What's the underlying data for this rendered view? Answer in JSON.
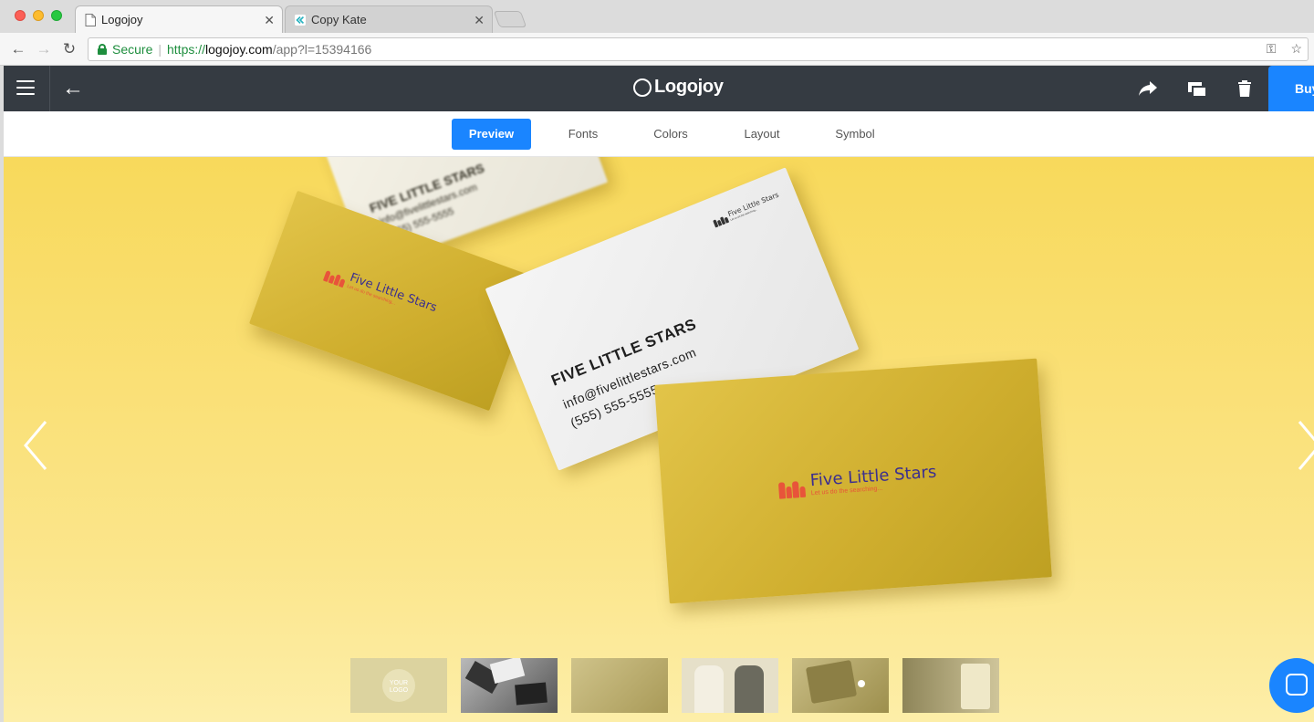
{
  "browser": {
    "tabs": [
      {
        "title": "Logojoy",
        "active": true
      },
      {
        "title": "Copy Kate",
        "active": false
      }
    ],
    "security_label": "Secure",
    "url": {
      "scheme": "https://",
      "host": "logojoy.com",
      "path": "/app?l=15394166"
    }
  },
  "app": {
    "brand": "Logojoy",
    "buy_label": "Buy",
    "accent_color": "#1a85ff",
    "header_color": "#353b42",
    "tabs": [
      {
        "label": "Preview",
        "active": true
      },
      {
        "label": "Fonts",
        "active": false
      },
      {
        "label": "Colors",
        "active": false
      },
      {
        "label": "Layout",
        "active": false
      },
      {
        "label": "Symbol",
        "active": false
      }
    ]
  },
  "mockup": {
    "company_name": "FIVE LITTLE STARS",
    "email": "info@fivelittlestars.com",
    "phone": "(555) 555-5555",
    "logo_name": "Five Little Stars",
    "logo_tagline": "Let us do the searching...",
    "card_color": "#d4b737",
    "bg_color": "#f9dd63"
  },
  "thumbnails": {
    "your_logo_label": "YOUR LOGO"
  }
}
